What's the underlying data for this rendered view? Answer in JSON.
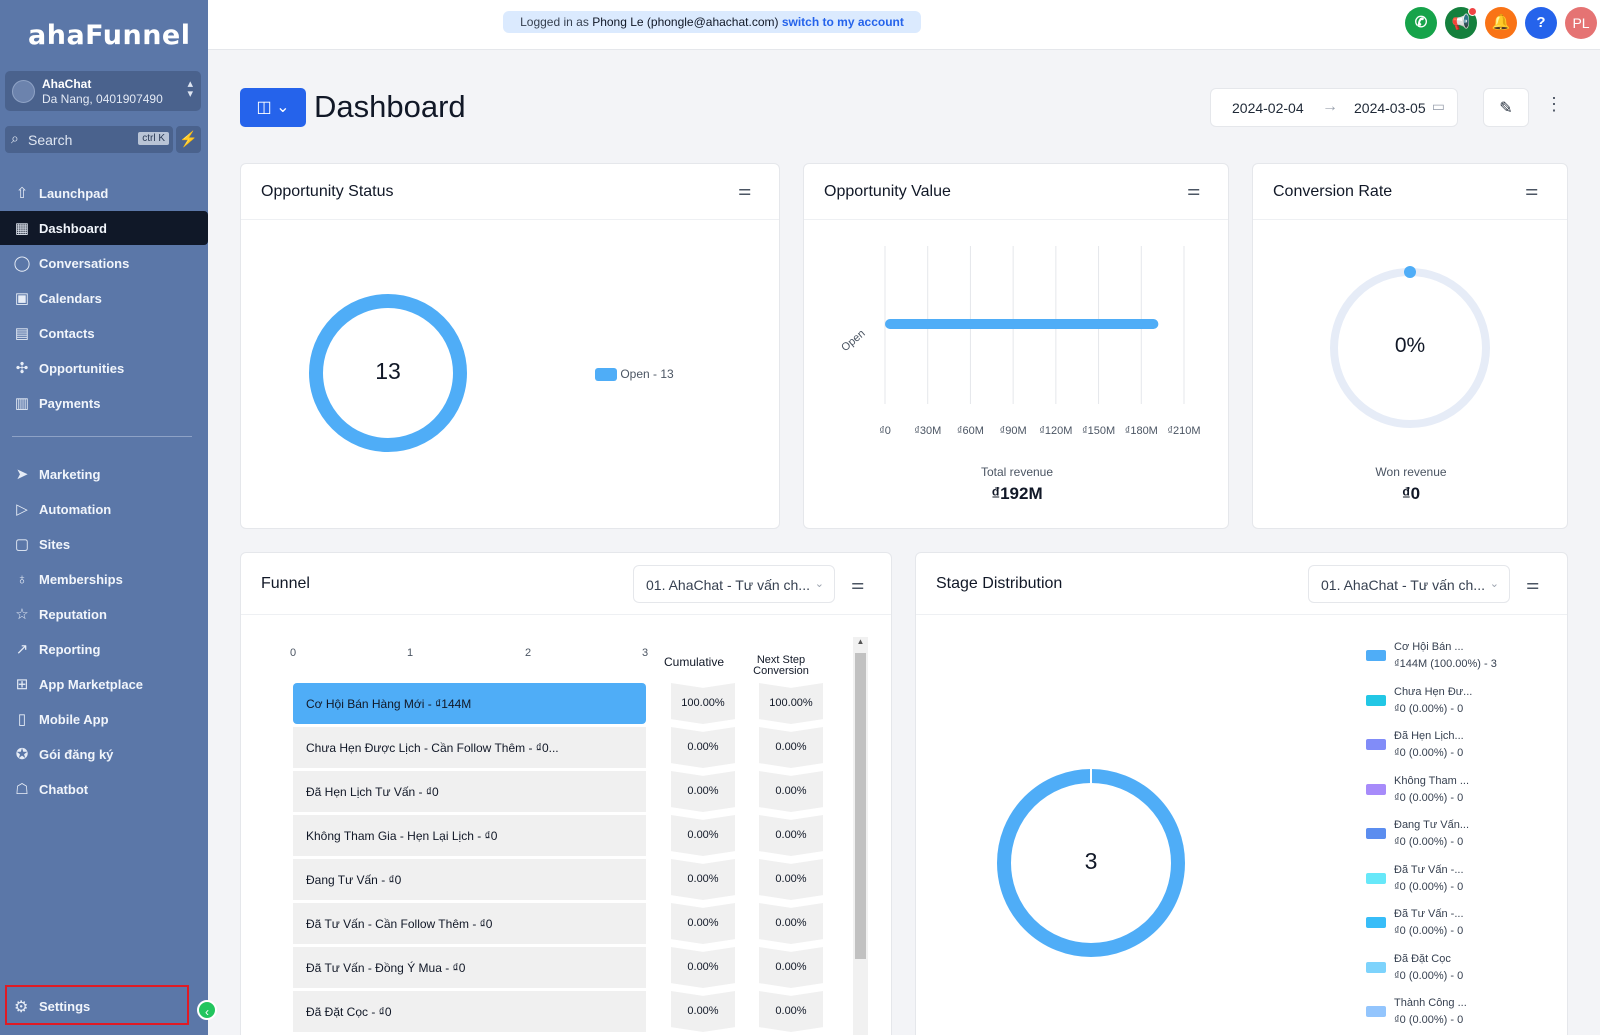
{
  "sidebar": {
    "logo": "ahaFunnel",
    "account": {
      "name": "AhaChat",
      "address": "Da Nang, 0401907490"
    },
    "search": {
      "placeholder": "Search",
      "shortcut": "ctrl K"
    },
    "items": [
      {
        "label": "Launchpad",
        "icon": "rocket-icon"
      },
      {
        "label": "Dashboard",
        "icon": "grid-icon",
        "active": true
      },
      {
        "label": "Conversations",
        "icon": "chat-icon"
      },
      {
        "label": "Calendars",
        "icon": "calendar-icon"
      },
      {
        "label": "Contacts",
        "icon": "contacts-icon"
      },
      {
        "label": "Opportunities",
        "icon": "network-icon"
      },
      {
        "label": "Payments",
        "icon": "receipt-icon"
      },
      {
        "label": "Marketing",
        "icon": "send-icon"
      },
      {
        "label": "Automation",
        "icon": "play-icon"
      },
      {
        "label": "Sites",
        "icon": "sites-icon"
      },
      {
        "label": "Memberships",
        "icon": "badge-icon"
      },
      {
        "label": "Reputation",
        "icon": "star-icon"
      },
      {
        "label": "Reporting",
        "icon": "trend-icon"
      },
      {
        "label": "App Marketplace",
        "icon": "apps-icon"
      },
      {
        "label": "Mobile App",
        "icon": "mobile-icon"
      },
      {
        "label": "Gói đăng ký",
        "icon": "award-icon"
      },
      {
        "label": "Chatbot",
        "icon": "robot-icon"
      }
    ],
    "settings_label": "Settings"
  },
  "topbar": {
    "impersonation_prefix": "Logged in as",
    "impersonation_user": "Phong Le (phongle@ahachat.com)",
    "impersonation_link": "switch to my account",
    "avatar_initials": "PL",
    "colors": {
      "phone": "#16a34a",
      "megaphone": "#15803d",
      "bell": "#f97316",
      "help": "#2563eb",
      "avatar": "#e57373"
    }
  },
  "header": {
    "title": "Dashboard",
    "date_start": "2024-02-04",
    "date_end": "2024-03-05"
  },
  "opportunity_status": {
    "title": "Opportunity Status",
    "total": "13",
    "legend": "Open - 13"
  },
  "opportunity_value": {
    "title": "Opportunity Value",
    "footer_label": "Total revenue",
    "footer_value": "₫192M"
  },
  "conversion_rate": {
    "title": "Conversion Rate",
    "value": "0%",
    "footer_label": "Won revenue",
    "footer_value": "₫0"
  },
  "funnel": {
    "title": "Funnel",
    "selected_pipeline": "01. AhaChat - Tư vấn ch...",
    "col_cumulative": "Cumulative",
    "col_next_step_line1": "Next Step",
    "col_next_step_line2": "Conversion",
    "axis_ticks": [
      "0",
      "1",
      "2",
      "3"
    ],
    "rows": [
      {
        "label": "Cơ Hội Bán Hàng Mới - ₫144M",
        "cumulative": "100.00%",
        "next": "100.00%"
      },
      {
        "label": "Chưa Hẹn Được Lịch - Cần Follow Thêm - ₫0...",
        "cumulative": "0.00%",
        "next": "0.00%"
      },
      {
        "label": "Đã Hẹn Lịch Tư Vấn - ₫0",
        "cumulative": "0.00%",
        "next": "0.00%"
      },
      {
        "label": "Không Tham Gia - Hẹn Lại Lịch - ₫0",
        "cumulative": "0.00%",
        "next": "0.00%"
      },
      {
        "label": "Đang Tư Vấn - ₫0",
        "cumulative": "0.00%",
        "next": "0.00%"
      },
      {
        "label": "Đã Tư Vấn - Cần Follow Thêm - ₫0",
        "cumulative": "0.00%",
        "next": "0.00%"
      },
      {
        "label": "Đã Tư Vấn - Đồng Ý Mua - ₫0",
        "cumulative": "0.00%",
        "next": "0.00%"
      },
      {
        "label": "Đã Đặt Cọc - ₫0",
        "cumulative": "0.00%",
        "next": "0.00%"
      }
    ]
  },
  "stage_distribution": {
    "title": "Stage Distribution",
    "selected_pipeline": "01. AhaChat - Tư vấn ch...",
    "total": "3",
    "legend": [
      {
        "name": "Cơ Hội Bán ...",
        "detail": "₫144M (100.00%) - 3",
        "color": "#4fadf7"
      },
      {
        "name": "Chưa Hẹn Đư...",
        "detail": "₫0 (0.00%) - 0",
        "color": "#22c7e5"
      },
      {
        "name": "Đã Hẹn Lịch...",
        "detail": "₫0 (0.00%) - 0",
        "color": "#818cf8"
      },
      {
        "name": "Không Tham ...",
        "detail": "₫0 (0.00%) - 0",
        "color": "#a78bfa"
      },
      {
        "name": "Đang Tư Vấn...",
        "detail": "₫0 (0.00%) - 0",
        "color": "#5b8def"
      },
      {
        "name": "Đã Tư Vấn -...",
        "detail": "₫0 (0.00%) - 0",
        "color": "#67e8f9"
      },
      {
        "name": "Đã Tư Vấn -...",
        "detail": "₫0 (0.00%) - 0",
        "color": "#38bdf8"
      },
      {
        "name": "Đã Đặt Cọc",
        "detail": "₫0 (0.00%) - 0",
        "color": "#7dd3fc"
      },
      {
        "name": "Thành Công ...",
        "detail": "₫0 (0.00%) - 0",
        "color": "#93c5fd"
      }
    ]
  },
  "chart_data": [
    {
      "type": "pie",
      "title": "Opportunity Status",
      "categories": [
        "Open"
      ],
      "values": [
        13
      ],
      "legend": "right"
    },
    {
      "type": "bar",
      "orientation": "horizontal",
      "title": "Opportunity Value",
      "categories": [
        "Open"
      ],
      "values": [
        192
      ],
      "unit": "₫M",
      "x_ticks": [
        "₫0",
        "₫30M",
        "₫60M",
        "₫90M",
        "₫120M",
        "₫150M",
        "₫180M",
        "₫210M"
      ],
      "xlim": [
        0,
        210
      ],
      "grid": true
    },
    {
      "type": "pie",
      "title": "Conversion Rate",
      "categories": [
        "Won"
      ],
      "values": [
        0
      ],
      "unit": "%"
    },
    {
      "type": "bar",
      "orientation": "horizontal",
      "title": "Funnel",
      "categories": [
        "Cơ Hội Bán Hàng Mới",
        "Chưa Hẹn Được Lịch - Cần Follow Thêm",
        "Đã Hẹn Lịch Tư Vấn",
        "Không Tham Gia - Hẹn Lại Lịch",
        "Đang Tư Vấn",
        "Đã Tư Vấn - Cần Follow Thêm",
        "Đã Tư Vấn - Đồng Ý Mua",
        "Đã Đặt Cọc"
      ],
      "values": [
        3,
        0,
        0,
        0,
        0,
        0,
        0,
        0
      ],
      "xlim": [
        0,
        3
      ]
    },
    {
      "type": "pie",
      "title": "Stage Distribution",
      "categories": [
        "Cơ Hội Bán ...",
        "Chưa Hẹn Đư...",
        "Đã Hẹn Lịch...",
        "Không Tham ...",
        "Đang Tư Vấn...",
        "Đã Tư Vấn -...",
        "Đã Tư Vấn -...",
        "Đã Đặt Cọc",
        "Thành Công ..."
      ],
      "values": [
        3,
        0,
        0,
        0,
        0,
        0,
        0,
        0,
        0
      ],
      "legend": "right"
    }
  ]
}
